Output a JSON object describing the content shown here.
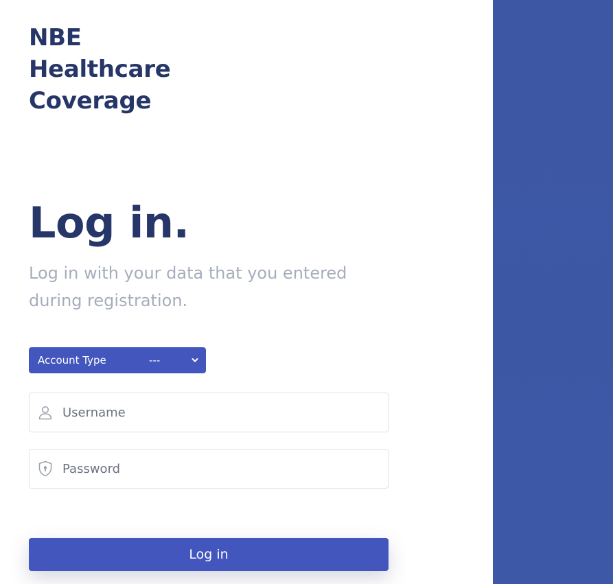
{
  "brand": {
    "line1": "NBE",
    "line2": "Healthcare",
    "line3": "Coverage"
  },
  "heading": "Log in.",
  "subtitle": "Log in with your data that you entered during registration.",
  "account_type": {
    "label": "Account Type",
    "value": "---"
  },
  "username": {
    "placeholder": "Username",
    "value": ""
  },
  "password": {
    "placeholder": "Password",
    "value": ""
  },
  "login_button": "Log in",
  "colors": {
    "accent": "#4356bd",
    "heading": "#263668",
    "subtitle": "#a6adbb",
    "side_panel": "#3d57a4"
  }
}
